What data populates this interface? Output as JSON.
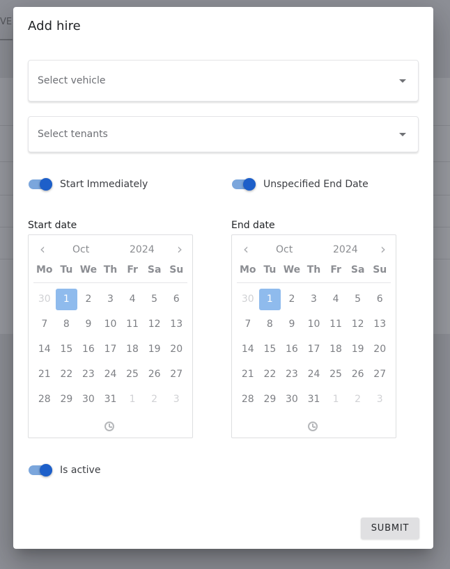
{
  "background": {
    "tab_partial": "VE"
  },
  "dialog": {
    "title": "Add hire",
    "vehicle_select": {
      "placeholder": "Select vehicle"
    },
    "tenants_select": {
      "placeholder": "Select tenants"
    },
    "toggles": {
      "start_immediately": {
        "label": "Start Immediately",
        "on": true
      },
      "unspecified_end_date": {
        "label": "Unspecified End Date",
        "on": true
      },
      "is_active": {
        "label": "Is active",
        "on": true
      }
    },
    "start_date": {
      "heading": "Start date",
      "month": "Oct",
      "year": "2024",
      "selected": "1",
      "weekdays": [
        "Mo",
        "Tu",
        "We",
        "Th",
        "Fr",
        "Sa",
        "Su"
      ]
    },
    "end_date": {
      "heading": "End date",
      "month": "Oct",
      "year": "2024",
      "selected": "1",
      "weekdays": [
        "Mo",
        "Tu",
        "We",
        "Th",
        "Fr",
        "Sa",
        "Su"
      ]
    },
    "calendar_days": [
      {
        "d": "30",
        "m": true
      },
      {
        "d": "1",
        "s": true
      },
      {
        "d": "2"
      },
      {
        "d": "3"
      },
      {
        "d": "4"
      },
      {
        "d": "5"
      },
      {
        "d": "6"
      },
      {
        "d": "7"
      },
      {
        "d": "8"
      },
      {
        "d": "9"
      },
      {
        "d": "10"
      },
      {
        "d": "11"
      },
      {
        "d": "12"
      },
      {
        "d": "13"
      },
      {
        "d": "14"
      },
      {
        "d": "15"
      },
      {
        "d": "16"
      },
      {
        "d": "17"
      },
      {
        "d": "18"
      },
      {
        "d": "19"
      },
      {
        "d": "20"
      },
      {
        "d": "21"
      },
      {
        "d": "22"
      },
      {
        "d": "23"
      },
      {
        "d": "24"
      },
      {
        "d": "25"
      },
      {
        "d": "26"
      },
      {
        "d": "27"
      },
      {
        "d": "28"
      },
      {
        "d": "29"
      },
      {
        "d": "30"
      },
      {
        "d": "31"
      },
      {
        "d": "1",
        "m": true
      },
      {
        "d": "2",
        "m": true
      },
      {
        "d": "3",
        "m": true
      }
    ],
    "submit_label": "SUBMIT",
    "colors": {
      "accent": "#1d5fc9",
      "track": "#7ba6dc",
      "selected_day": "#8fbbed"
    }
  }
}
